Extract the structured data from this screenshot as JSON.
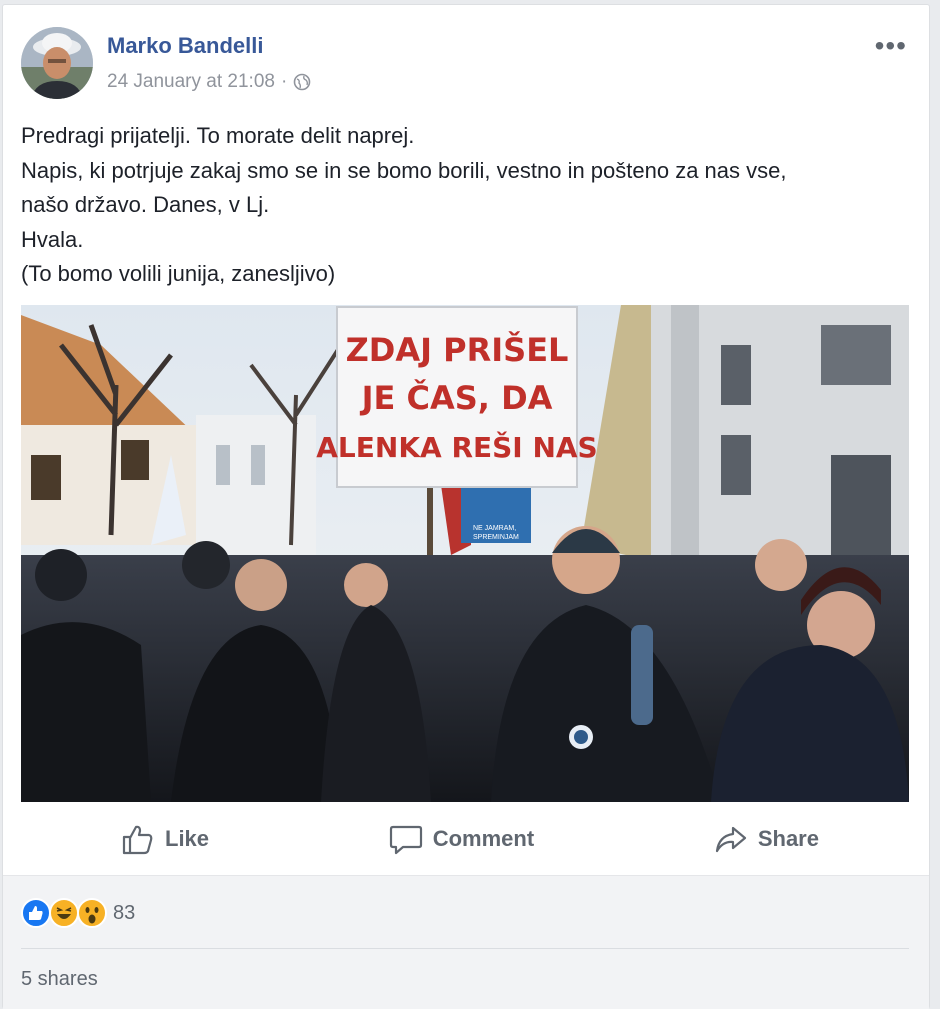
{
  "post": {
    "author": "Marko Bandelli",
    "timestamp": "24 January at 21:08",
    "separator": "·",
    "privacy_icon": "globe-icon",
    "more_label": "•••",
    "text_lines": [
      "Predragi prijatelji. To morate delit naprej.",
      "Napis, ki potrjuje zakaj smo se in se bomo borili, vestno in pošteno za nas vse,",
      "našo državo. Danes, v Lj.",
      "Hvala.",
      "(To bomo volili junija, zanesljivo)"
    ],
    "photo": {
      "sign_lines": [
        "ZDAJ PRIŠEL",
        "JE ČAS, DA",
        "ALENKA REŠI NAS"
      ],
      "small_sign": [
        "NE JAMRAM,",
        "SPREMINJAM"
      ]
    }
  },
  "actions": {
    "like": "Like",
    "comment": "Comment",
    "share": "Share"
  },
  "footer": {
    "reaction_icons": [
      "like-reaction-icon",
      "haha-reaction-icon",
      "wow-reaction-icon"
    ],
    "reaction_count": "83",
    "shares": "5 shares"
  },
  "colors": {
    "link": "#385898",
    "secondary": "#606770",
    "like_blue": "#1877f2",
    "reaction_yellow": "#f7b125",
    "sign_red": "#c0302a"
  }
}
